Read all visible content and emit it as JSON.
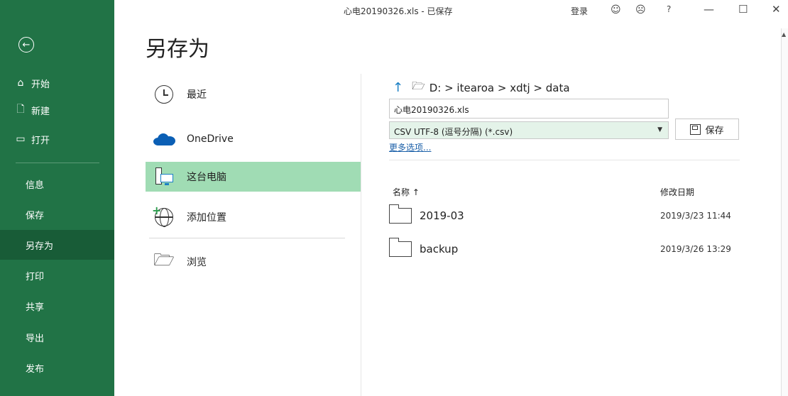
{
  "title_bar": {
    "document_title": "心电20190326.xls  -  已保存",
    "login_label": "登录",
    "smiley_icon": "smiley-face-icon",
    "frown_icon": "frown-face-icon",
    "help_label": "?",
    "minimize_label": "—",
    "maximize_label": "☐",
    "close_label": "✕"
  },
  "sidebar": {
    "back_label": "←",
    "top_items": [
      {
        "icon": "⌂",
        "label": "开始"
      },
      {
        "icon": "🗋",
        "label": "新建"
      },
      {
        "icon": "▭",
        "label": "打开"
      }
    ],
    "items": [
      {
        "label": "信息"
      },
      {
        "label": "保存"
      },
      {
        "label": "另存为"
      },
      {
        "label": "打印"
      },
      {
        "label": "共享"
      },
      {
        "label": "导出"
      },
      {
        "label": "发布"
      }
    ],
    "active_item": "另存为",
    "colors": {
      "background": "#217346",
      "active": "#185c37"
    }
  },
  "page": {
    "title": "另存为"
  },
  "locations": [
    {
      "label": "最近",
      "icon": "clock-icon"
    },
    {
      "label": "OneDrive",
      "icon": "cloud-icon"
    },
    {
      "label": "这台电脑",
      "icon": "this-pc-icon"
    },
    {
      "label": "添加位置",
      "icon": "globe-add-icon"
    },
    {
      "label": "浏览",
      "icon": "folder-open-icon"
    }
  ],
  "active_location": "这台电脑",
  "save_panel": {
    "path": "D: > itearoa > xdtj > data",
    "filename": "心电20190326.xls",
    "filetype": "CSV UTF-8 (逗号分隔) (*.csv)",
    "more_options": "更多选项...",
    "save_button": "保存"
  },
  "file_list": {
    "columns": {
      "name": "名称 ↑",
      "date": "修改日期"
    },
    "rows": [
      {
        "name": "2019-03",
        "date": "2019/3/23 11:44"
      },
      {
        "name": "backup",
        "date": "2019/3/26 13:29"
      }
    ]
  }
}
